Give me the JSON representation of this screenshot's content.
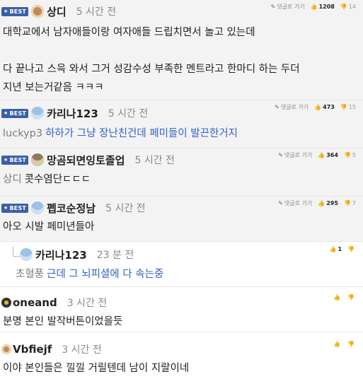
{
  "badge": {
    "best_label": "BEST",
    "star": "★"
  },
  "meta_labels": {
    "report_label": "댓글로 가기"
  },
  "comments": [
    {
      "nick": "상디",
      "time": "5 시간 전",
      "best": true,
      "avatar": "dog-avatar",
      "likes": "1208",
      "dislikes": "14",
      "lines": [
        "대학교에서 남자애들이랑 여자애들 드립치면서 놀고 있는데",
        "",
        "다 끝나고 스윽 와서 그거 성감수성 부족한 멘트라고 한마디 하는 두더",
        "지년 보는거같음 ㅋㅋㅋ"
      ]
    },
    {
      "nick": "카리나123",
      "time": "5 시간 전",
      "best": true,
      "avatar": "ghost-avatar",
      "likes": "473",
      "dislikes": "15",
      "mention": "luckyp3",
      "text": "하하가 그냥 장난친건데 페미들이 발끈한거지"
    },
    {
      "nick": "망곰되면잉토졸업",
      "time": "5 시간 전",
      "best": true,
      "avatar": "bowl-avatar",
      "likes": "364",
      "dislikes": "5",
      "mention": "상디",
      "text": "콧수염단ㄷㄷㄷ"
    },
    {
      "nick": "펩코순정남",
      "time": "5 시간 전",
      "best": true,
      "avatar": "ghost-avatar",
      "likes": "295",
      "dislikes": "7",
      "text": "아오 시발 페미년들아"
    },
    {
      "nick": "카리나123",
      "time": "23 분 전",
      "best": false,
      "avatar": "ghost-avatar",
      "likes": "1",
      "dislikes": "",
      "mention": "초혈풍",
      "text": "근데 그 뇌피셜에 다 속는중"
    },
    {
      "nick": "oneand",
      "time": "3 시간 전",
      "best": false,
      "avatar": "bee-avatar",
      "text": "분명 본인 발작버튼이었을듯"
    },
    {
      "nick": "Vbfiejf",
      "time": "3 시간 전",
      "best": false,
      "avatar": "dog-avatar",
      "text": "이야 본인들은 낄낄 거릴텐데 남이 지랄이네"
    }
  ]
}
